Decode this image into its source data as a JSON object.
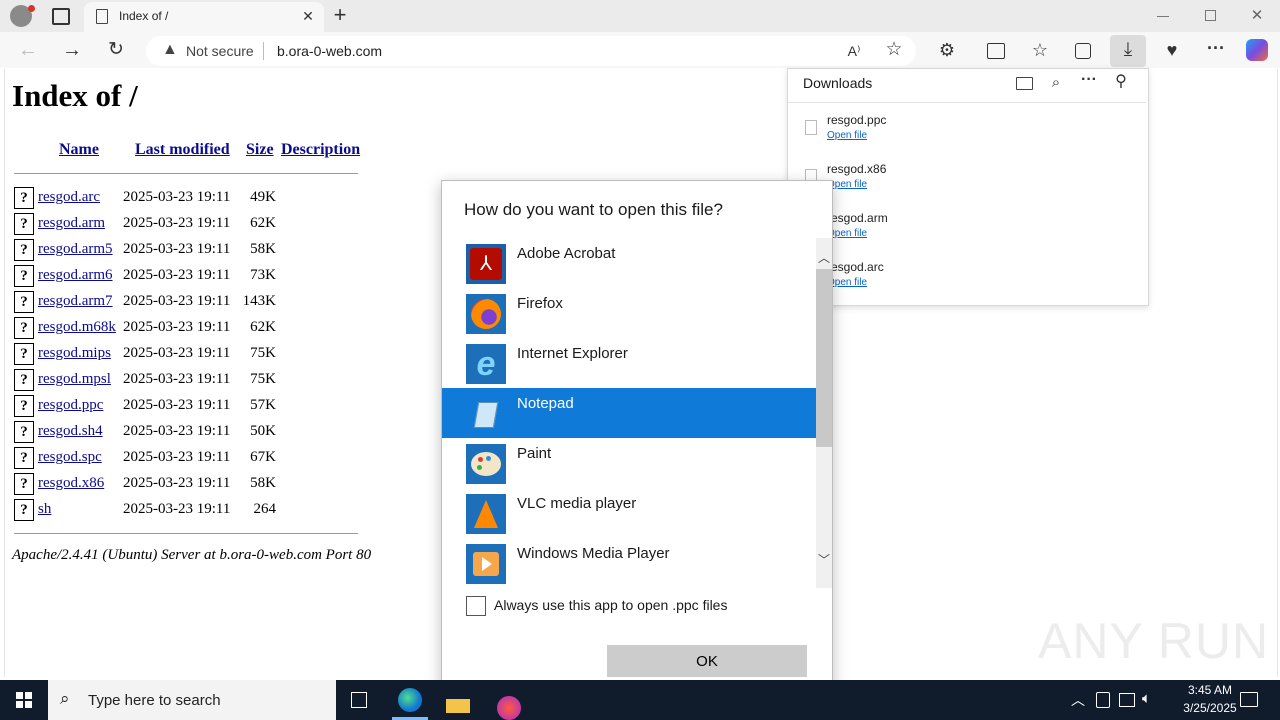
{
  "browser": {
    "tab_title": "Index of /",
    "new_tab_symbol": "+",
    "security_label": "Not secure",
    "url": "b.ora-0-web.com"
  },
  "index": {
    "title": "Index of /",
    "headers": {
      "name": "Name",
      "modified": "Last modified",
      "size": "Size",
      "description": "Description"
    },
    "rows": [
      {
        "name": "resgod.arc",
        "date": "2025-03-23 19:11",
        "size": "49K"
      },
      {
        "name": "resgod.arm",
        "date": "2025-03-23 19:11",
        "size": "62K"
      },
      {
        "name": "resgod.arm5",
        "date": "2025-03-23 19:11",
        "size": "58K"
      },
      {
        "name": "resgod.arm6",
        "date": "2025-03-23 19:11",
        "size": "73K"
      },
      {
        "name": "resgod.arm7",
        "date": "2025-03-23 19:11",
        "size": "143K"
      },
      {
        "name": "resgod.m68k",
        "date": "2025-03-23 19:11",
        "size": "62K"
      },
      {
        "name": "resgod.mips",
        "date": "2025-03-23 19:11",
        "size": "75K"
      },
      {
        "name": "resgod.mpsl",
        "date": "2025-03-23 19:11",
        "size": "75K"
      },
      {
        "name": "resgod.ppc",
        "date": "2025-03-23 19:11",
        "size": "57K"
      },
      {
        "name": "resgod.sh4",
        "date": "2025-03-23 19:11",
        "size": "50K"
      },
      {
        "name": "resgod.spc",
        "date": "2025-03-23 19:11",
        "size": "67K"
      },
      {
        "name": "resgod.x86",
        "date": "2025-03-23 19:11",
        "size": "58K"
      },
      {
        "name": "sh",
        "date": "2025-03-23 19:11",
        "size": "264"
      }
    ],
    "footer": "Apache/2.4.41 (Ubuntu) Server at b.ora-0-web.com Port 80"
  },
  "downloads": {
    "title": "Downloads",
    "items": [
      {
        "name": "resgod.ppc",
        "action": "Open file"
      },
      {
        "name": "resgod.x86",
        "action": "Open file"
      },
      {
        "name": "resgod.arm",
        "action": "Open file"
      },
      {
        "name": "resgod.arc",
        "action": "Open file"
      }
    ]
  },
  "dialog": {
    "title": "How do you want to open this file?",
    "apps": [
      {
        "label": "Adobe Acrobat",
        "icon": "acrobat-icon"
      },
      {
        "label": "Firefox",
        "icon": "firefox-icon"
      },
      {
        "label": "Internet Explorer",
        "icon": "ie-icon"
      },
      {
        "label": "Notepad",
        "icon": "notepad-icon",
        "selected": true
      },
      {
        "label": "Paint",
        "icon": "paint-icon"
      },
      {
        "label": "VLC media player",
        "icon": "vlc-icon"
      },
      {
        "label": "Windows Media Player",
        "icon": "wmp-icon"
      }
    ],
    "always_label": "Always use this app to open .ppc files",
    "ok_label": "OK"
  },
  "taskbar": {
    "search_placeholder": "Type here to search",
    "time": "3:45 AM",
    "date": "3/25/2025"
  },
  "watermark": "ANY RUN",
  "colors": {
    "selection": "#0f7ad8",
    "link": "#0b0b8f",
    "taskbar": "#101b2b"
  }
}
